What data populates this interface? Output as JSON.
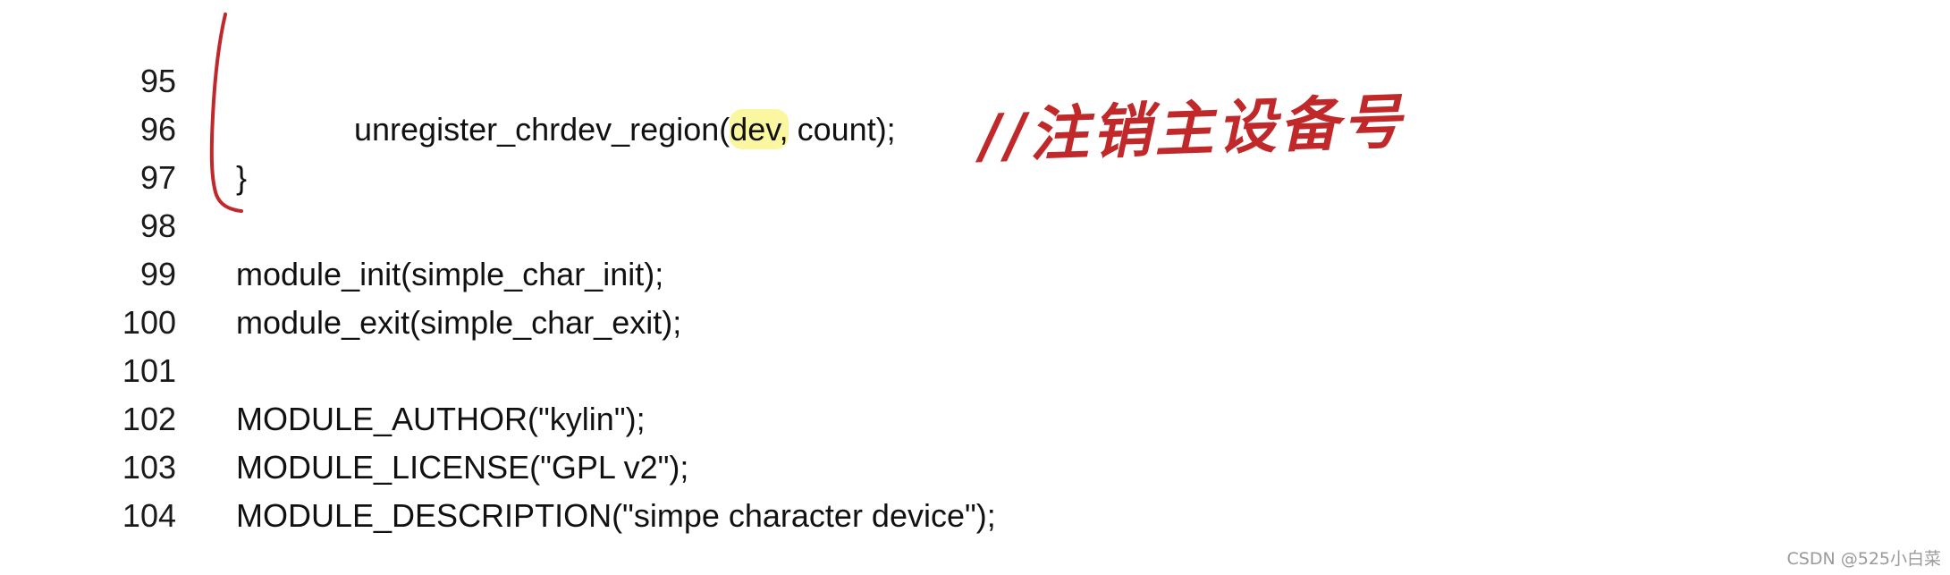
{
  "code": {
    "lines": [
      {
        "num": "95",
        "text": ""
      },
      {
        "num": "96",
        "pre": "unregister_chrdev_region(",
        "highlight": "dev,",
        "post": " count);"
      },
      {
        "num": "97",
        "text": "}"
      },
      {
        "num": "98",
        "text": ""
      },
      {
        "num": "99",
        "text": "module_init(simple_char_init);"
      },
      {
        "num": "100",
        "text": "module_exit(simple_char_exit);"
      },
      {
        "num": "101",
        "text": ""
      },
      {
        "num": "102",
        "text": "MODULE_AUTHOR(\"kylin\");"
      },
      {
        "num": "103",
        "text": "MODULE_LICENSE(\"GPL v2\");"
      },
      {
        "num": "104",
        "text": "MODULE_DESCRIPTION(\"simpe character device\");"
      }
    ]
  },
  "annotation": {
    "text": "//注销主设备号",
    "color": "#c0282a"
  },
  "highlight_color": "#fbf7a0",
  "watermark": "CSDN @525小白菜"
}
